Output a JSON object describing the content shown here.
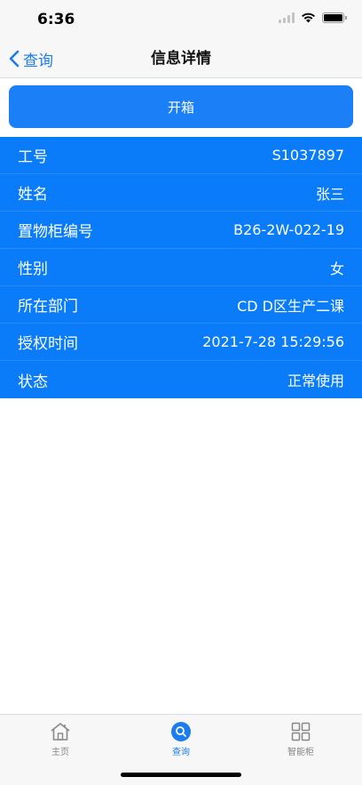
{
  "status_bar": {
    "time": "6:36"
  },
  "nav": {
    "back_label": "查询",
    "title": "信息详情"
  },
  "actions": {
    "open_label": "开箱"
  },
  "info": [
    {
      "label": "工号",
      "value": "S1037897"
    },
    {
      "label": "姓名",
      "value": "张三"
    },
    {
      "label": "置物柜编号",
      "value": "B26-2W-022-19"
    },
    {
      "label": "性别",
      "value": "女"
    },
    {
      "label": "所在部门",
      "value": "CD D区生产二课"
    },
    {
      "label": "授权时间",
      "value": "2021-7-28 15:29:56"
    },
    {
      "label": "状态",
      "value": "正常使用"
    }
  ],
  "tabs": [
    {
      "label": "主页",
      "icon": "home-icon",
      "active": false
    },
    {
      "label": "查询",
      "icon": "search-icon",
      "active": true
    },
    {
      "label": "智能柜",
      "icon": "grid-icon",
      "active": false
    }
  ],
  "colors": {
    "accent": "#1a7cf0",
    "list_background": "#0a7cf9",
    "button_background": "#1b7ff7"
  }
}
